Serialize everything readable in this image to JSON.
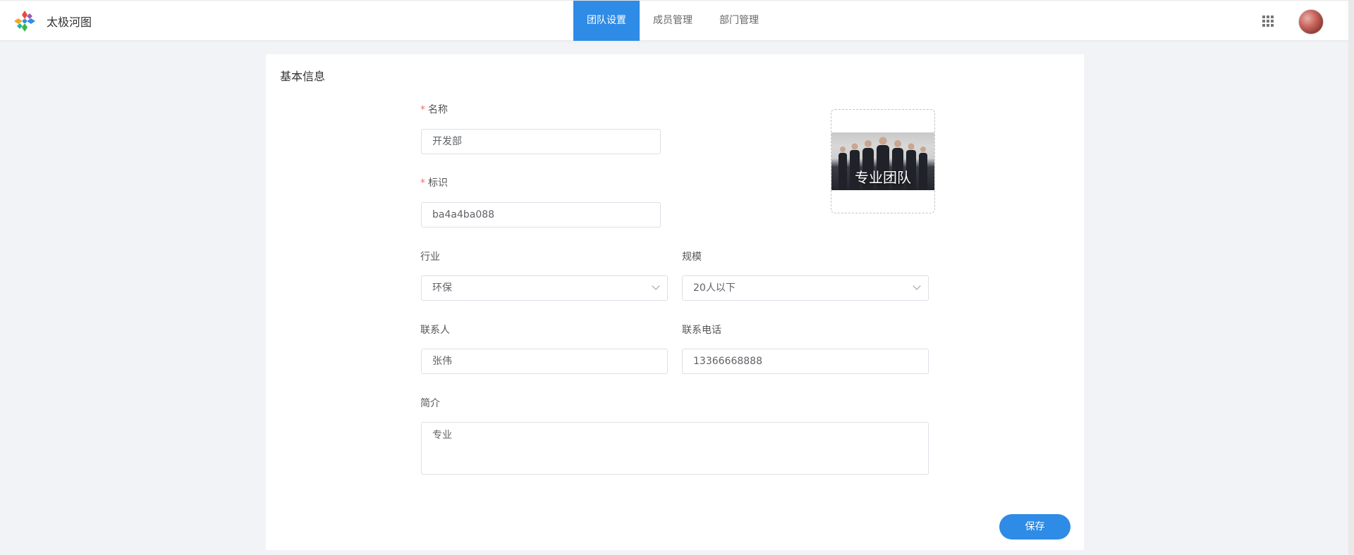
{
  "header": {
    "brand_name": "太极河图",
    "nav": [
      {
        "label": "团队设置",
        "active": true
      },
      {
        "label": "成员管理",
        "active": false
      },
      {
        "label": "部门管理",
        "active": false
      }
    ],
    "accent_color": "#2e8be6"
  },
  "card": {
    "title": "基本信息",
    "fields": {
      "name": {
        "label": "名称",
        "required_mark": "*",
        "value": "开发部"
      },
      "identifier": {
        "label": "标识",
        "required_mark": "*",
        "value": "ba4a4ba088"
      },
      "industry": {
        "label": "行业",
        "value": "环保"
      },
      "scale": {
        "label": "规模",
        "value": "20人以下"
      },
      "contact": {
        "label": "联系人",
        "value": "张伟"
      },
      "phone": {
        "label": "联系电话",
        "value": "13366668888"
      },
      "intro": {
        "label": "简介",
        "value": "专业"
      }
    },
    "image": {
      "caption": "专业团队"
    },
    "save_label": "保存"
  },
  "icons": [
    "logo-icon",
    "apps-grid-icon",
    "chevron-down-icon"
  ]
}
